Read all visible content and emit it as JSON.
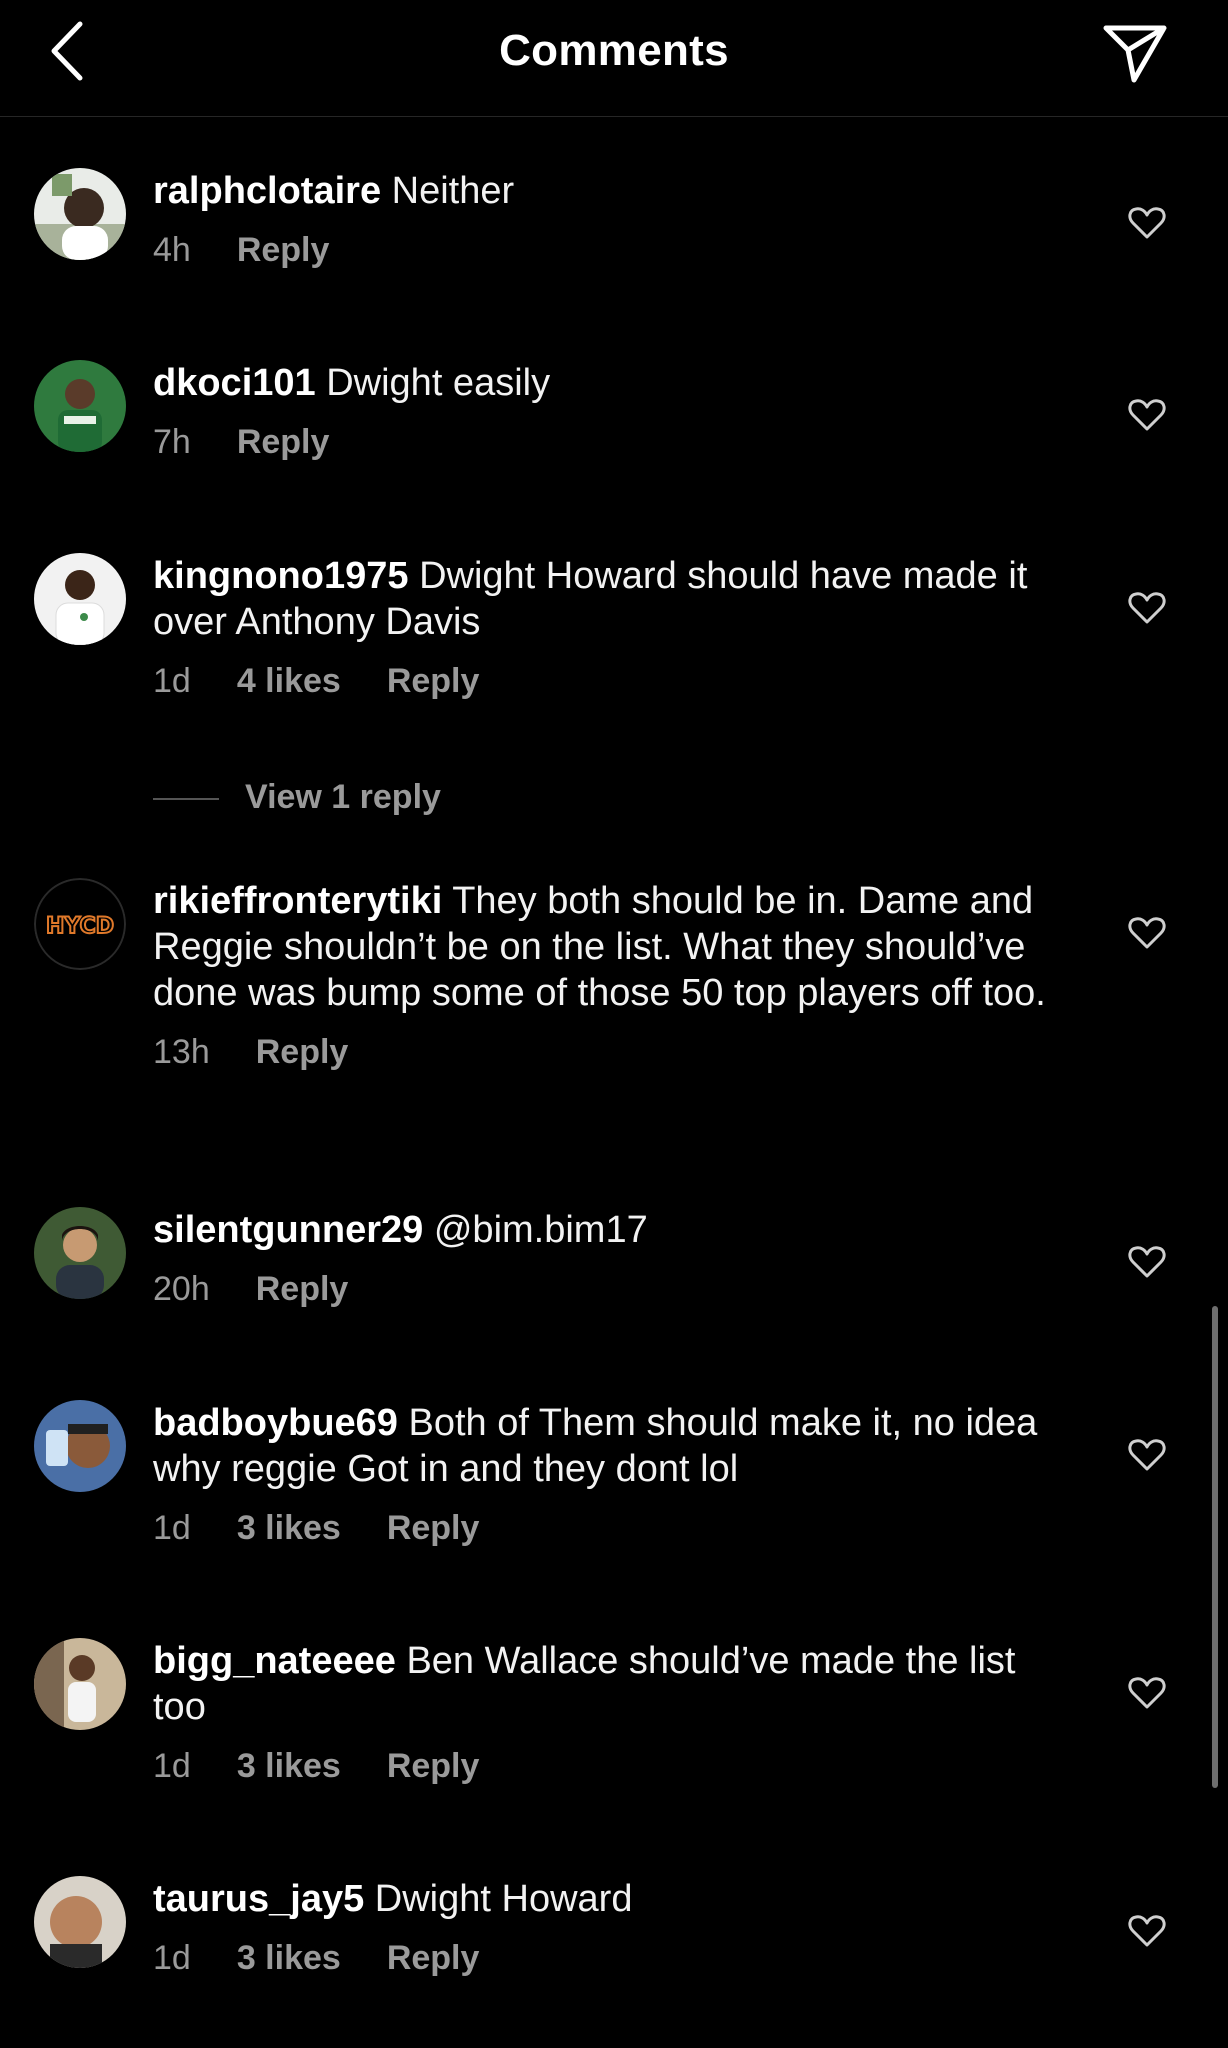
{
  "header": {
    "title": "Comments",
    "back_icon": "chevron-left-icon",
    "send_icon": "paper-plane-icon"
  },
  "comments": [
    {
      "username": "ralphclotaire",
      "text": "Neither",
      "time": "4h",
      "likes": "",
      "reply": "Reply"
    },
    {
      "username": "dkoci101",
      "text": "Dwight easily",
      "time": "7h",
      "likes": "",
      "reply": "Reply"
    },
    {
      "username": "kingnono1975",
      "text": "Dwight Howard should have made it over Anthony Davis",
      "time": "1d",
      "likes": "4 likes",
      "reply": "Reply"
    },
    {
      "username": "rikieffronterytiki",
      "text": "They both should be in. Dame and Reggie shouldn’t be on the list. What they should’ve done was bump some of those 50 top players off too.",
      "time": "13h",
      "likes": "",
      "reply": "Reply"
    },
    {
      "username": "silentgunner29",
      "text": "@bim.bim17",
      "time": "20h",
      "likes": "",
      "reply": "Reply"
    },
    {
      "username": "badboybue69",
      "text": "Both of Them should make it, no idea why reggie Got in and they dont lol",
      "time": "1d",
      "likes": "3 likes",
      "reply": "Reply"
    },
    {
      "username": "bigg_nateeee",
      "text": "Ben Wallace should’ve made the list too",
      "time": "1d",
      "likes": "3 likes",
      "reply": "Reply"
    },
    {
      "username": "taurus_jay5",
      "text": "Dwight Howard",
      "time": "1d",
      "likes": "3 likes",
      "reply": "Reply"
    }
  ],
  "view_replies": {
    "label": "View 1 reply"
  },
  "avatar_badge": "HYCD",
  "colors": {
    "background": "#000000",
    "text": "#f2f2f2",
    "muted": "#9a9a9a"
  }
}
